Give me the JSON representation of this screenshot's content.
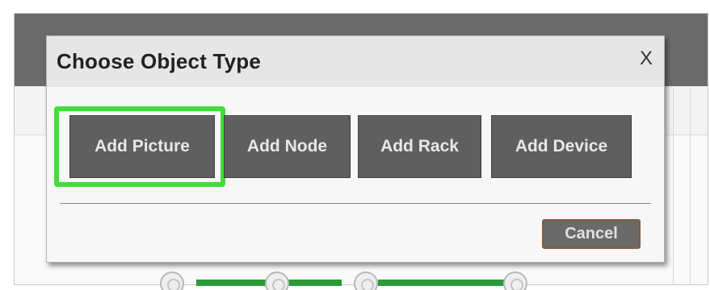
{
  "dialog": {
    "title": "Choose Object Type",
    "close_label": "X",
    "options": [
      {
        "label": "Add Picture",
        "highlighted": true
      },
      {
        "label": "Add Node",
        "highlighted": false
      },
      {
        "label": "Add Rack",
        "highlighted": false
      },
      {
        "label": "Add Device",
        "highlighted": false
      }
    ],
    "cancel_label": "Cancel"
  },
  "colors": {
    "header_bar": "#6b6b6b",
    "dialog_background": "#f7f7f7",
    "dialog_header": "#e6e6e6",
    "button_fill": "#5f5f5f",
    "button_text": "#e8e8e8",
    "highlight": "#3ee03a",
    "cancel_border": "#8a5a3a"
  }
}
